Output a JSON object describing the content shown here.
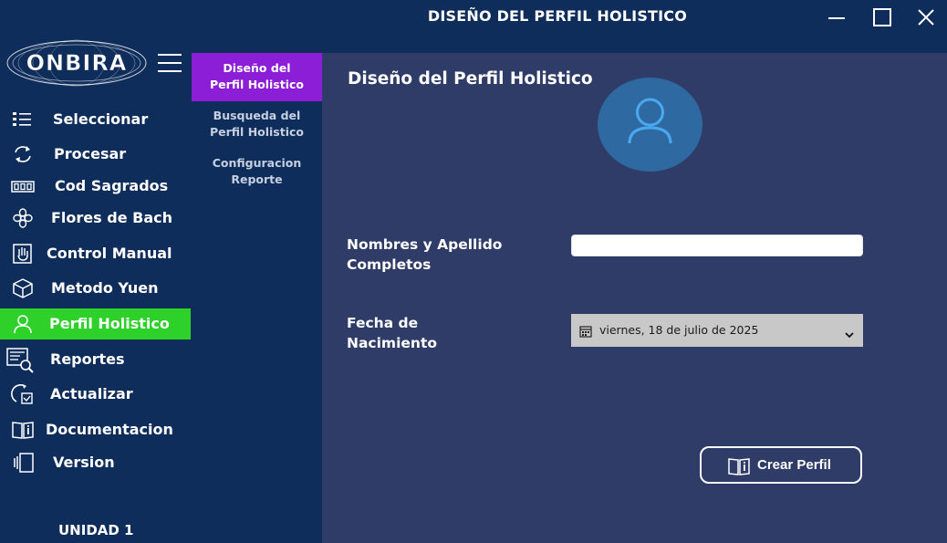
{
  "window": {
    "title": "DISEÑO DEL PERFIL HOLISTICO",
    "controls": [
      "minimize-icon",
      "maximize-icon",
      "close-icon"
    ]
  },
  "logo": {
    "text": "ONBIRA"
  },
  "sidebar": {
    "items": [
      {
        "label": "Seleccionar",
        "icon": "list-icon"
      },
      {
        "label": "Procesar",
        "icon": "refresh-icon"
      },
      {
        "label": "Cod Sagrados",
        "icon": "counter-icon"
      },
      {
        "label": "Flores de Bach",
        "icon": "flower-icon"
      },
      {
        "label": "Control Manual",
        "icon": "hand-icon"
      },
      {
        "label": "Metodo Yuen",
        "icon": "cube-icon"
      },
      {
        "label": "Perfil Holistico",
        "icon": "user-icon",
        "active": true
      },
      {
        "label": "Reportes",
        "icon": "report-search-icon"
      },
      {
        "label": "Actualizar",
        "icon": "update-check-icon"
      },
      {
        "label": "Documentacion",
        "icon": "book-info-icon"
      },
      {
        "label": "Version",
        "icon": "version-icon"
      }
    ],
    "footer": "UNIDAD 1"
  },
  "submenu": {
    "items": [
      {
        "line1": "Diseño del",
        "line2": "Perfil Holistico",
        "active": true
      },
      {
        "line1": "Busqueda del",
        "line2": "Perfil Holistico"
      },
      {
        "line1": "Configuracion",
        "line2": "Reporte"
      }
    ]
  },
  "main": {
    "title": "Diseño del Perfil Holistico",
    "avatar_icon": "user-icon",
    "name_label_1": "Nombres y Apellido",
    "name_label_2": "Completos",
    "name_value": "",
    "birth_label_1": "Fecha de",
    "birth_label_2": "Nacimiento",
    "birth_value": "viernes, 18 de julio de 2025",
    "create_button": "Crear Perfil"
  },
  "colors": {
    "titlebar": "#0f2d5a",
    "main_bg": "#2e3c67",
    "active_nav": "#2ed12a",
    "active_submenu": "#8d1ed8",
    "avatar_bg": "#2f69a1"
  }
}
